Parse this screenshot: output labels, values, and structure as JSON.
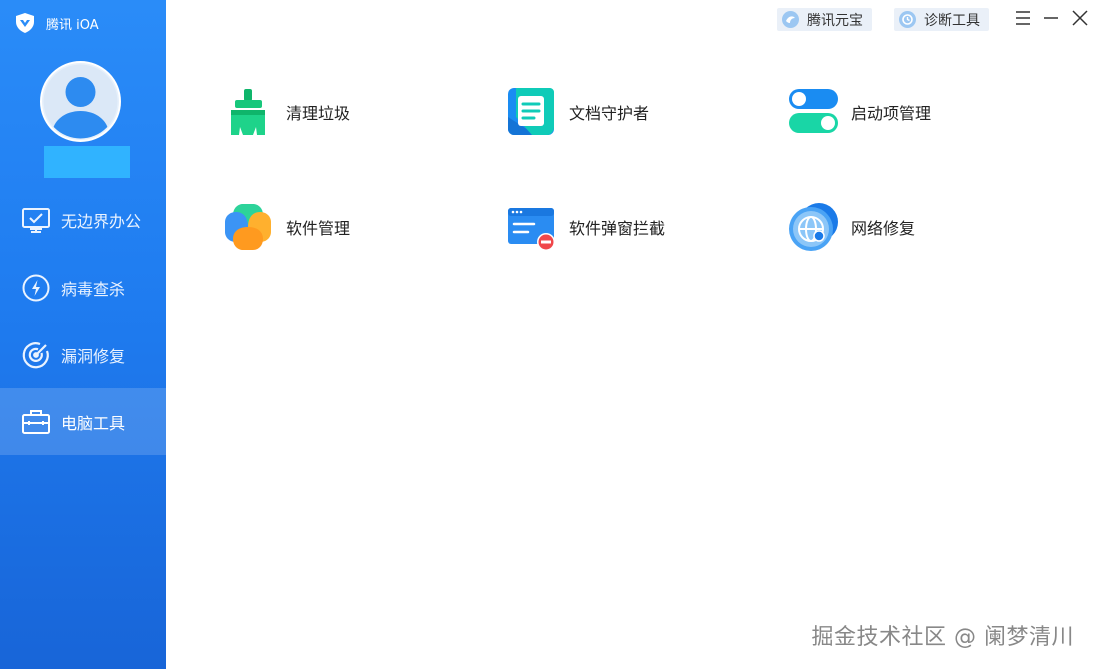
{
  "app": {
    "brand": "腾讯 iOA"
  },
  "header": {
    "yuanbao_label": "腾讯元宝",
    "diagnose_label": "诊断工具",
    "menu_icon": "menu-icon",
    "minimize_icon": "minimize-icon",
    "close_icon": "close-icon"
  },
  "sidebar": {
    "items": [
      {
        "label": "无边界办公",
        "icon": "monitor-icon",
        "active": false
      },
      {
        "label": "病毒查杀",
        "icon": "virus-scan-icon",
        "active": false
      },
      {
        "label": "漏洞修复",
        "icon": "target-icon",
        "active": false
      },
      {
        "label": "电脑工具",
        "icon": "toolbox-icon",
        "active": true
      }
    ]
  },
  "tools": [
    {
      "label": "清理垃圾",
      "icon": "broom-icon"
    },
    {
      "label": "文档守护者",
      "icon": "document-icon"
    },
    {
      "label": "启动项管理",
      "icon": "toggle-icon"
    },
    {
      "label": "软件管理",
      "icon": "clover-icon"
    },
    {
      "label": "软件弹窗拦截",
      "icon": "popup-block-icon"
    },
    {
      "label": "网络修复",
      "icon": "globe-icon"
    }
  ],
  "watermark": "掘金技术社区 @ 阑梦清川",
  "colors": {
    "sidebar_top": "#2a8cf8",
    "sidebar_bottom": "#1865d8",
    "accent": "#1f7cf0"
  }
}
